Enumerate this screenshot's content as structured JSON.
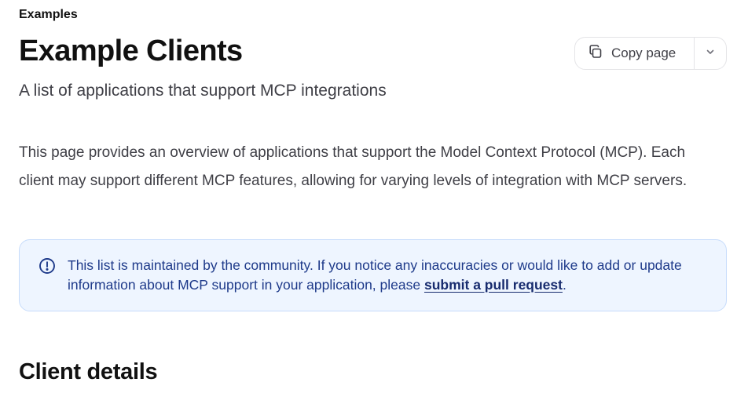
{
  "breadcrumb": "Examples",
  "page": {
    "title": "Example Clients",
    "subtitle": "A list of applications that support MCP integrations",
    "intro": "This page provides an overview of applications that support the Model Context Protocol (MCP). Each client may support different MCP features, allowing for varying levels of integration with MCP servers."
  },
  "copy_button": {
    "label": "Copy page",
    "icon": "copy-icon",
    "menu_icon": "chevron-down-icon"
  },
  "callout": {
    "icon": "info-circle-icon",
    "text_before": "This list is maintained by the community. If you notice any inaccuracies or would like to add or update information about MCP support in your application, please ",
    "link_text": "submit a pull request",
    "text_after": ".",
    "colors": {
      "background": "#eef5ff",
      "border": "#c7dcfb",
      "text": "#1e3a8a"
    }
  },
  "section": {
    "title": "Client details"
  }
}
